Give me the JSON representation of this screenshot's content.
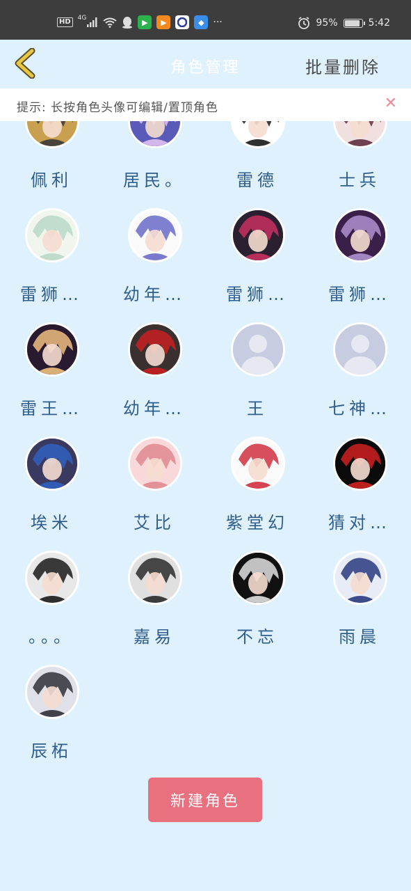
{
  "status_bar": {
    "hd": "HD",
    "network": "4G",
    "battery": "95%",
    "battery_level": 0.95,
    "time": "5:42",
    "more": "···"
  },
  "header": {
    "title": "角色管理",
    "batch_delete": "批量删除"
  },
  "tip": {
    "text": "提示: 长按角色头像可编辑/置顶角色",
    "close": "✕"
  },
  "characters": [
    {
      "name": "佩利",
      "palette": [
        "#c8a050",
        "#3a3a3a"
      ]
    },
    {
      "name": "居民。",
      "palette": [
        "#5a5ab8",
        "#e0c0f0"
      ]
    },
    {
      "name": "雷德",
      "palette": [
        "#ffffff",
        "#1a1a1a"
      ]
    },
    {
      "name": "士兵",
      "palette": [
        "#f0e0e0",
        "#603040"
      ]
    },
    {
      "name": "雷狮…",
      "palette": [
        "#f0f6ee",
        "#b8d8c8"
      ]
    },
    {
      "name": "幼年…",
      "palette": [
        "#fafafa",
        "#6a6ac8"
      ]
    },
    {
      "name": "雷狮…",
      "palette": [
        "#2a2030",
        "#c83060"
      ]
    },
    {
      "name": "雷狮…",
      "palette": [
        "#3a2048",
        "#b090d0"
      ]
    },
    {
      "name": "雷王…",
      "palette": [
        "#2a1a30",
        "#f0c080"
      ]
    },
    {
      "name": "幼年…",
      "palette": [
        "#3a3030",
        "#c82020"
      ]
    },
    {
      "name": "王",
      "palette": [
        "#c8cce0",
        "#e6e8f2"
      ]
    },
    {
      "name": "七神…",
      "palette": [
        "#c8cce0",
        "#e6e8f2"
      ]
    },
    {
      "name": "埃米",
      "palette": [
        "#3a3a60",
        "#3060c0"
      ]
    },
    {
      "name": "艾比",
      "palette": [
        "#f8d8d8",
        "#e08890"
      ]
    },
    {
      "name": "紫堂幻",
      "palette": [
        "#fafafa",
        "#d03040"
      ]
    },
    {
      "name": "猜对…",
      "palette": [
        "#0a0a0a",
        "#d02020"
      ]
    },
    {
      "name": "。。。",
      "palette": [
        "#e8e8e8",
        "#1a1a1a"
      ]
    },
    {
      "name": "嘉易",
      "palette": [
        "#e0e0e0",
        "#2a2a2a"
      ]
    },
    {
      "name": "不忘",
      "palette": [
        "#111111",
        "#e0e0e0"
      ]
    },
    {
      "name": "雨晨",
      "palette": [
        "#e8ecf6",
        "#2a3a80"
      ]
    },
    {
      "name": "辰柘",
      "palette": [
        "#e0e0e8",
        "#303038"
      ]
    }
  ],
  "new_button": "新建角色",
  "colors": {
    "background": "#dff1fc",
    "name_text": "#2f5d8c",
    "accent": "#e9707f",
    "back_arrow": "#e8c840"
  }
}
